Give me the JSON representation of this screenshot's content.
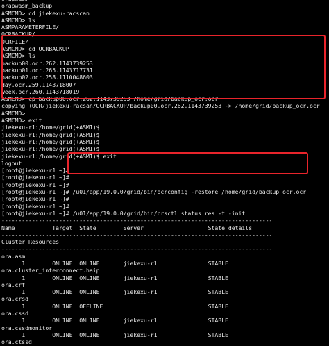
{
  "terminal": {
    "lines": [
      "orapwasm",
      "orapwasm_backup",
      "ASMCMD> cd jiekexu-racscan",
      "ASMCMD> ls",
      "ASMPARAMETERFILE/",
      "OCRBACKUP/",
      "OCRFILE/",
      "ASMCMD> cd OCRBACKUP",
      "ASMCMD> ls",
      "backup00.ocr.262.1143739253",
      "backup01.ocr.265.1143717731",
      "backup02.ocr.258.1110048603",
      "day.ocr.259.1143718007",
      "week.ocr.260.1143718019",
      "ASMCMD> cp backup00.ocr.262.1143739253 /home/grid/backup_ocr.ocr",
      "copying +OCR/jiekexu-racsan/OCRBACKUP/backup00.ocr.262.1143739253 -> /home/grid/backup_ocr.ocr",
      "ASMCMD>",
      "ASMCMD> exit",
      "jiekexu-r1:/home/grid(+ASM1)$",
      "jiekexu-r1:/home/grid(+ASM1)$",
      "jiekexu-r1:/home/grid(+ASM1)$",
      "jiekexu-r1:/home/grid(+ASM1)$",
      "jiekexu-r1:/home/grid(+ASM1)$ exit",
      "logout",
      "[root@jiekexu-r1 ~]#",
      "[root@jiekexu-r1 ~]#",
      "[root@jiekexu-r1 ~]#",
      "[root@jiekexu-r1 ~]# /u01/app/19.0.0/grid/bin/ocrconfig -restore /home/grid/backup_ocr.ocr",
      "[root@jiekexu-r1 ~]#",
      "[root@jiekexu-r1 ~]#",
      "[root@jiekexu-r1 ~]# /u01/app/19.0.0/grid/bin/crsctl status res -t -init",
      "--------------------------------------------------------------------------------",
      "Name           Target  State        Server                   State details",
      "--------------------------------------------------------------------------------",
      "Cluster Resources",
      "--------------------------------------------------------------------------------",
      "ora.asm",
      "      1        ONLINE  ONLINE       jiekexu-r1               STABLE",
      "ora.cluster_interconnect.haip",
      "      1        ONLINE  ONLINE       jiekexu-r1               STABLE",
      "ora.crf",
      "      1        ONLINE  ONLINE       jiekexu-r1               STABLE",
      "ora.crsd",
      "      1        ONLINE  OFFLINE                               STABLE",
      "ora.cssd",
      "      1        ONLINE  ONLINE       jiekexu-r1               STABLE",
      "ora.cssdmonitor",
      "      1        ONLINE  ONLINE       jiekexu-r1               STABLE",
      "ora.ctssd"
    ]
  },
  "highlights": {
    "color": "#e8242b"
  }
}
